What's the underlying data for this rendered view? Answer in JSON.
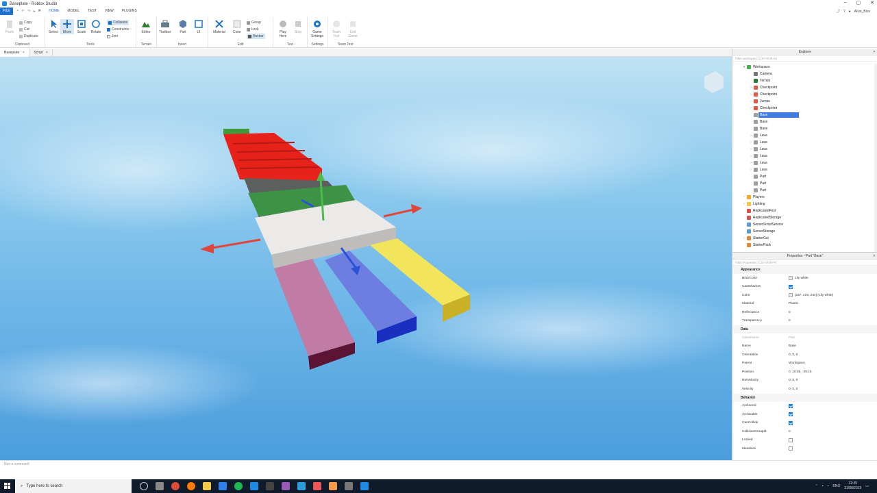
{
  "window": {
    "title": "Baseplate - Roblox Studio",
    "user": "Alvin_Blox"
  },
  "menu": {
    "file": "FILE",
    "tabs": [
      "HOME",
      "MODEL",
      "TEST",
      "VIEW",
      "PLUGINS"
    ]
  },
  "ribbon": {
    "clipboard": {
      "label": "Clipboard",
      "paste": "Paste",
      "copy": "Copy",
      "cut": "Cut",
      "duplicate": "Duplicate"
    },
    "tools": {
      "label": "Tools",
      "select": "Select",
      "move": "Move",
      "scale": "Scale",
      "rotate": "Rotate",
      "collisions": "Collisions",
      "constraints": "Constraints",
      "join": "Join"
    },
    "terrain": {
      "label": "Terrain",
      "editor": "Editor"
    },
    "insert": {
      "label": "Insert",
      "toolbox": "Toolbox",
      "part": "Part",
      "ui": "UI"
    },
    "edit": {
      "label": "Edit",
      "material": "Material",
      "color": "Color",
      "group": "Group",
      "lock": "Lock",
      "anchor": "Anchor"
    },
    "test": {
      "label": "Test",
      "play_here": "Play Here",
      "stop": "Stop"
    },
    "settings": {
      "label": "Settings",
      "game_settings": "Game Settings"
    },
    "team_test": {
      "label": "Team Test",
      "team_test": "Team Test",
      "exit_game": "Exit Game"
    }
  },
  "doc_tabs": [
    "Baseplate",
    "Script"
  ],
  "command_bar": {
    "placeholder": "Run a command"
  },
  "explorer": {
    "title": "Explorer",
    "filter": "Filter workspace (Ctrl+Shift+X)",
    "items": [
      {
        "label": "Workspace",
        "depth": 0,
        "arrow": "▾",
        "icon": "workspace-icon",
        "color": "#4caf50"
      },
      {
        "label": "Camera",
        "depth": 1,
        "arrow": "",
        "icon": "camera-icon",
        "color": "#777777"
      },
      {
        "label": "Terrain",
        "depth": 1,
        "arrow": "",
        "icon": "terrain-icon",
        "color": "#2e7d32"
      },
      {
        "label": "Checkpoint",
        "depth": 1,
        "arrow": "›",
        "icon": "model-icon",
        "color": "#e25b4a"
      },
      {
        "label": "Checkpoint",
        "depth": 1,
        "arrow": "›",
        "icon": "model-icon",
        "color": "#e25b4a"
      },
      {
        "label": "Jumps",
        "depth": 1,
        "arrow": "›",
        "icon": "model-icon",
        "color": "#e25b4a"
      },
      {
        "label": "Checkpoint",
        "depth": 1,
        "arrow": "›",
        "icon": "model-icon",
        "color": "#e25b4a"
      },
      {
        "label": "Base",
        "depth": 1,
        "arrow": "",
        "icon": "part-icon",
        "color": "#9e9e9e",
        "selected": true
      },
      {
        "label": "Base",
        "depth": 1,
        "arrow": "",
        "icon": "part-icon",
        "color": "#9e9e9e"
      },
      {
        "label": "Base",
        "depth": 1,
        "arrow": "",
        "icon": "part-icon",
        "color": "#9e9e9e"
      },
      {
        "label": "Lava",
        "depth": 1,
        "arrow": "›",
        "icon": "part-icon",
        "color": "#9e9e9e"
      },
      {
        "label": "Lava",
        "depth": 1,
        "arrow": "›",
        "icon": "part-icon",
        "color": "#9e9e9e"
      },
      {
        "label": "Lava",
        "depth": 1,
        "arrow": "›",
        "icon": "part-icon",
        "color": "#9e9e9e"
      },
      {
        "label": "Lava",
        "depth": 1,
        "arrow": "›",
        "icon": "part-icon",
        "color": "#9e9e9e"
      },
      {
        "label": "Lava",
        "depth": 1,
        "arrow": "›",
        "icon": "part-icon",
        "color": "#9e9e9e"
      },
      {
        "label": "Lava",
        "depth": 1,
        "arrow": "›",
        "icon": "part-icon",
        "color": "#9e9e9e"
      },
      {
        "label": "Part",
        "depth": 1,
        "arrow": "",
        "icon": "part-icon",
        "color": "#9e9e9e"
      },
      {
        "label": "Part",
        "depth": 1,
        "arrow": "",
        "icon": "part-icon",
        "color": "#9e9e9e"
      },
      {
        "label": "Part",
        "depth": 1,
        "arrow": "",
        "icon": "part-icon",
        "color": "#9e9e9e"
      },
      {
        "label": "Players",
        "depth": 0,
        "arrow": "›",
        "icon": "players-icon",
        "color": "#f5a623"
      },
      {
        "label": "Lighting",
        "depth": 0,
        "arrow": "›",
        "icon": "lighting-icon",
        "color": "#f6c343"
      },
      {
        "label": "ReplicatedFirst",
        "depth": 0,
        "arrow": "",
        "icon": "replicated-first-icon",
        "color": "#d9534f"
      },
      {
        "label": "ReplicatedStorage",
        "depth": 0,
        "arrow": "",
        "icon": "replicated-storage-icon",
        "color": "#d9534f"
      },
      {
        "label": "ServerScriptService",
        "depth": 0,
        "arrow": "",
        "icon": "server-script-service-icon",
        "color": "#5b9bd5"
      },
      {
        "label": "ServerStorage",
        "depth": 0,
        "arrow": "",
        "icon": "server-storage-icon",
        "color": "#5b9bd5"
      },
      {
        "label": "StarterGui",
        "depth": 0,
        "arrow": "›",
        "icon": "starter-gui-icon",
        "color": "#e08a3c"
      },
      {
        "label": "StarterPack",
        "depth": 0,
        "arrow": "",
        "icon": "starter-pack-icon",
        "color": "#e08a3c"
      }
    ]
  },
  "properties": {
    "title": "Properties - Part \"Base\"",
    "filter": "Filter Properties (Ctrl+Shift+P)",
    "sections": [
      {
        "name": "Appearance",
        "rows": [
          {
            "name": "BrickColor",
            "value": "Lily white",
            "type": "swatch"
          },
          {
            "name": "CastShadow",
            "value": "",
            "type": "check",
            "checked": true
          },
          {
            "name": "Color",
            "value": "[237, 234, 234] (Lily white)",
            "type": "swatch"
          },
          {
            "name": "Material",
            "value": "Plastic",
            "type": "text"
          },
          {
            "name": "Reflectance",
            "value": "0",
            "type": "text"
          },
          {
            "name": "Transparency",
            "value": "0",
            "type": "text"
          }
        ]
      },
      {
        "name": "Data",
        "rows": [
          {
            "name": "ClassName",
            "value": "Part",
            "type": "text",
            "dim": true
          },
          {
            "name": "Name",
            "value": "Base",
            "type": "text"
          },
          {
            "name": "Orientation",
            "value": "0, 0, 0",
            "type": "text"
          },
          {
            "name": "Parent",
            "value": "Workspace",
            "type": "text"
          },
          {
            "name": "Position",
            "value": "0, 10.65, -251.5",
            "type": "text"
          },
          {
            "name": "RotVelocity",
            "value": "0, 0, 0",
            "type": "text"
          },
          {
            "name": "Velocity",
            "value": "0, 0, 0",
            "type": "text"
          }
        ]
      },
      {
        "name": "Behavior",
        "rows": [
          {
            "name": "Anchored",
            "value": "",
            "type": "check",
            "checked": true
          },
          {
            "name": "Archivable",
            "value": "",
            "type": "check",
            "checked": true
          },
          {
            "name": "CanCollide",
            "value": "",
            "type": "check",
            "checked": true
          },
          {
            "name": "CollisionGroupId",
            "value": "0",
            "type": "text"
          },
          {
            "name": "Locked",
            "value": "",
            "type": "check",
            "checked": false
          },
          {
            "name": "Massless",
            "value": "",
            "type": "check",
            "checked": false
          }
        ]
      }
    ]
  },
  "taskbar": {
    "search": "Type here to search",
    "lang": "ENG",
    "time": "12:45",
    "date": "31/08/2019"
  }
}
